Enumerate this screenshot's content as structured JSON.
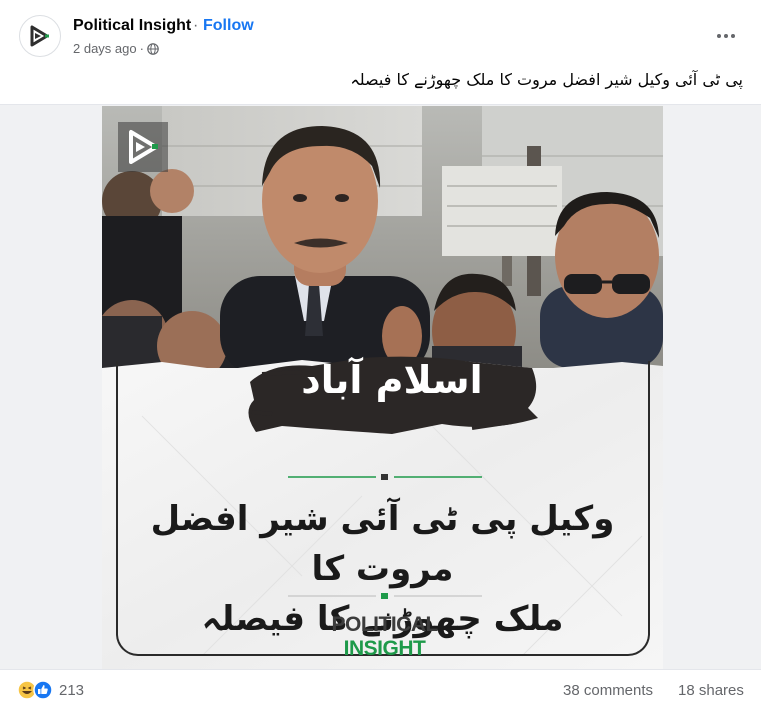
{
  "post": {
    "page_name": "Political Insight",
    "separator": "·",
    "follow_label": "Follow",
    "time": "2 days ago",
    "meta_separator": "·",
    "audience_icon": "globe-icon",
    "more_icon": "more-horizontal-icon",
    "caption": "پی ٹی آئی وکیل شیر افضل مروت کا ملک چھوڑنے کا فیصلہ"
  },
  "media": {
    "city": "اسلام آباد",
    "headline_line1": "وکیل پی ٹی آئی شیر افضل مروت کا",
    "headline_line2": "ملک چھوڑنے کا فیصلہ",
    "brand_part1": "POLITICAL",
    "brand_part2": "INSIGHT",
    "colors": {
      "brand_green": "#1e9a4a",
      "brand_dark": "#3c3c3c",
      "brush": "#2b2726"
    }
  },
  "footer": {
    "reaction_icons": [
      "haha-icon",
      "like-icon"
    ],
    "reaction_count": "213",
    "comments": "38 comments",
    "shares": "18 shares"
  },
  "colors": {
    "link_blue": "#1877f2",
    "secondary_text": "#65676b"
  }
}
